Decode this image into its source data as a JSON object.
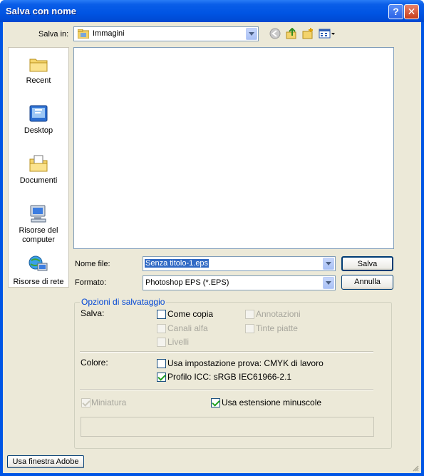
{
  "window": {
    "title": "Salva con nome",
    "help": "?",
    "close": "✕"
  },
  "toolbar": {
    "save_in_label": "Salva in:",
    "location": "Immagini"
  },
  "places": [
    {
      "label": "Recent",
      "icon": "folder-recent-icon"
    },
    {
      "label": "Desktop",
      "icon": "desktop-icon"
    },
    {
      "label": "Documenti",
      "icon": "documents-folder-icon"
    },
    {
      "label": "Risorse del computer",
      "icon": "my-computer-icon"
    },
    {
      "label": "Risorse di rete",
      "icon": "network-icon"
    }
  ],
  "form": {
    "filename_label": "Nome file:",
    "filename_value": "Senza titolo-1.eps",
    "format_label": "Formato:",
    "format_value": "Photoshop EPS (*.EPS)",
    "save_button": "Salva",
    "cancel_button": "Annulla"
  },
  "options": {
    "title": "Opzioni di salvataggio",
    "save_label": "Salva:",
    "come_copia": "Come copia",
    "annotazioni": "Annotazioni",
    "canali_alfa": "Canali alfa",
    "tinte_piatte": "Tinte piatte",
    "livelli": "Livelli",
    "color_label": "Colore:",
    "proof_setup": "Usa impostazione prova:  CMYK di lavoro",
    "icc_profile": "Profilo ICC:  sRGB IEC61966-2.1",
    "thumbnail": "Miniatura",
    "lowercase_ext": "Usa estensione minuscole"
  },
  "footer": {
    "adobe_dialog_button": "Usa finestra Adobe"
  },
  "colors": {
    "titlebar": "#0054e3",
    "dialog_bg": "#ece9d8",
    "accent_blue": "#0046d5",
    "check_green": "#21a121"
  }
}
